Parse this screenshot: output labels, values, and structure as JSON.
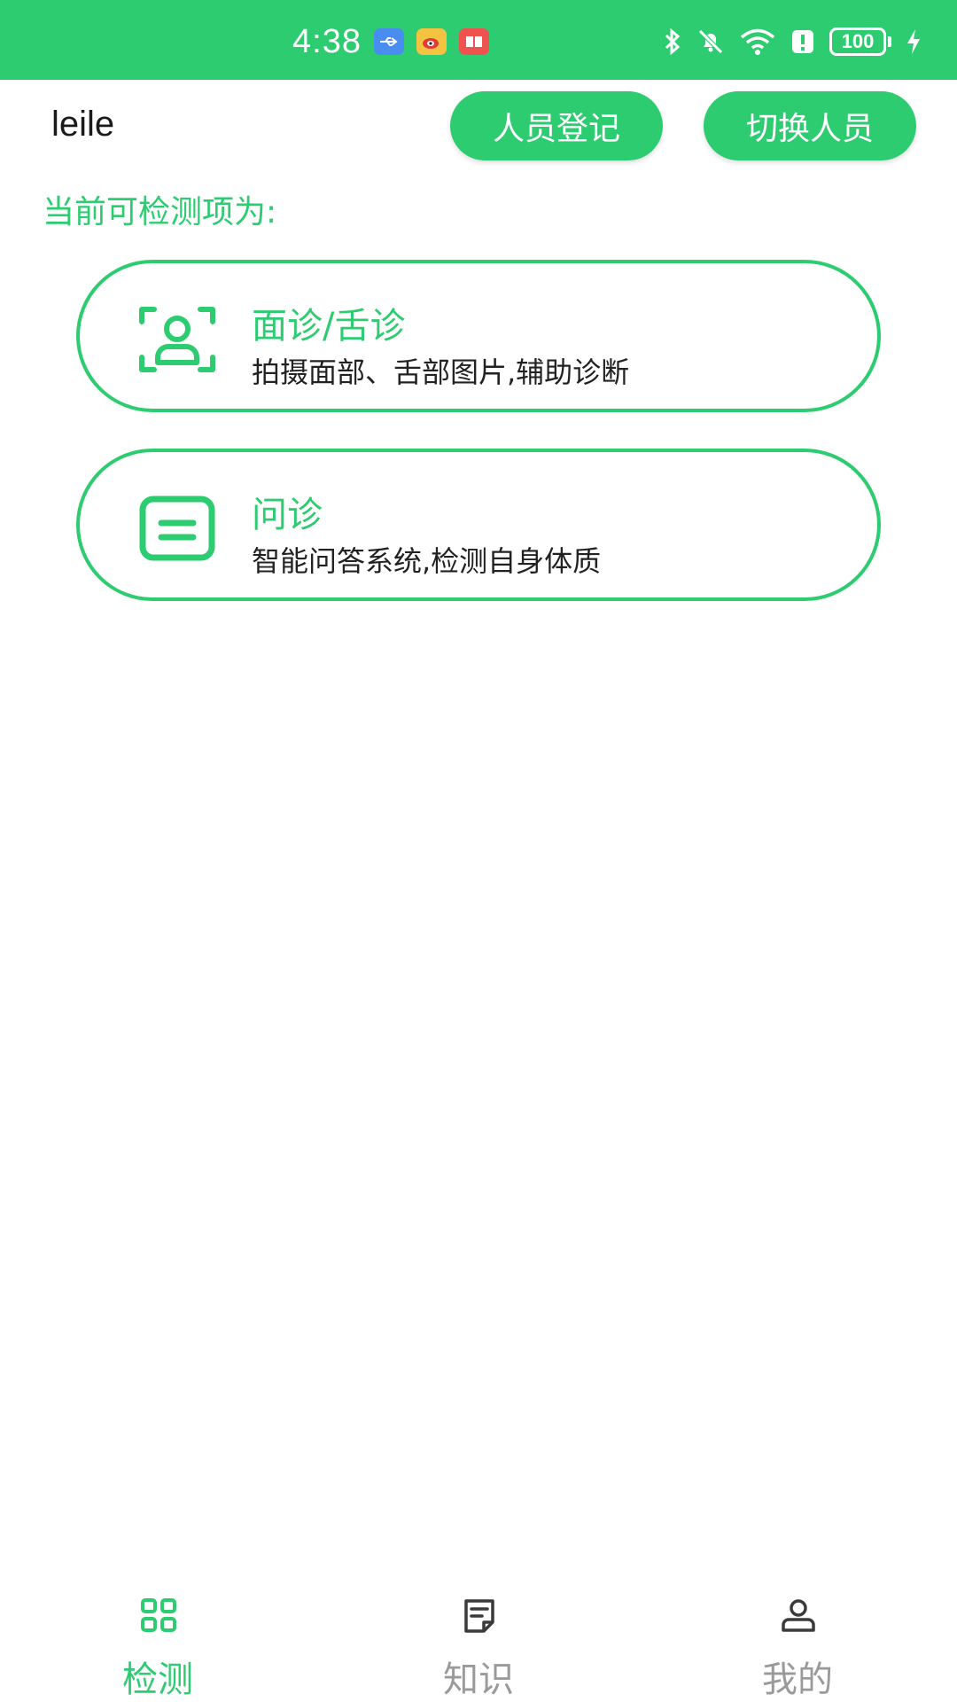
{
  "status_bar": {
    "time": "4:38",
    "battery": "100",
    "bg_color": "#2ecc71",
    "icons": [
      "usb-icon",
      "weibo-icon",
      "book-icon",
      "bluetooth-icon",
      "mute-icon",
      "wifi-icon",
      "alert-icon",
      "battery-icon",
      "charging-icon"
    ]
  },
  "header": {
    "username": "leile",
    "register_label": "人员登记",
    "switch_label": "切换人员"
  },
  "section": {
    "title": "当前可检测项为:"
  },
  "cards": [
    {
      "title": "面诊/舌诊",
      "desc": "拍摄面部、舌部图片,辅助诊断",
      "icon": "face-scan-icon"
    },
    {
      "title": "问诊",
      "desc": "智能问答系统,检测自身体质",
      "icon": "list-icon"
    }
  ],
  "bottom_nav": {
    "items": [
      {
        "label": "检测",
        "icon": "grid-icon",
        "active": true
      },
      {
        "label": "知识",
        "icon": "notes-icon",
        "active": false
      },
      {
        "label": "我的",
        "icon": "user-icon",
        "active": false
      }
    ]
  },
  "colors": {
    "accent": "#2ecc71",
    "inactive": "#9a9a9a",
    "text": "#222222"
  }
}
